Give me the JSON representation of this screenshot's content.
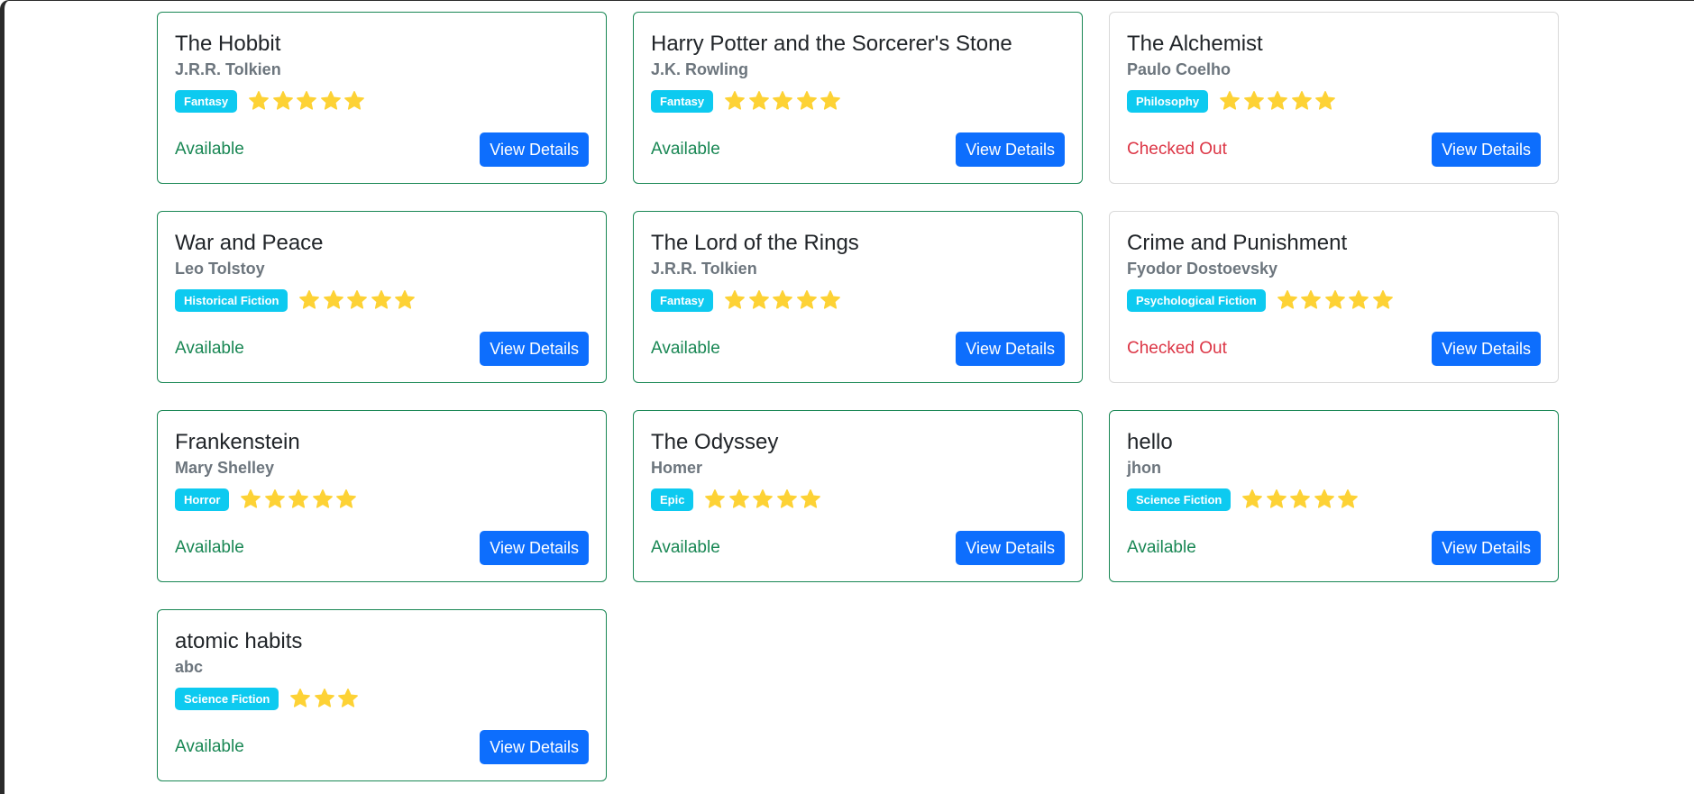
{
  "colors": {
    "available_border": "#198754",
    "checked_out_border": "#d9d9d9",
    "available_text": "#198754",
    "checked_out_text": "#dc3545",
    "badge_bg": "#0dcaf0",
    "button_bg": "#0d6efd",
    "star": "#fdd235"
  },
  "books": [
    {
      "title": "The Hobbit",
      "author": "J.R.R. Tolkien",
      "genre": "Fantasy",
      "rating": 5,
      "status": "Available",
      "available": true,
      "button_label": "View Details"
    },
    {
      "title": "Harry Potter and the Sorcerer's Stone",
      "author": "J.K. Rowling",
      "genre": "Fantasy",
      "rating": 5,
      "status": "Available",
      "available": true,
      "button_label": "View Details"
    },
    {
      "title": "The Alchemist",
      "author": "Paulo Coelho",
      "genre": "Philosophy",
      "rating": 5,
      "status": "Checked Out",
      "available": false,
      "button_label": "View Details"
    },
    {
      "title": "War and Peace",
      "author": "Leo Tolstoy",
      "genre": "Historical Fiction",
      "rating": 5,
      "status": "Available",
      "available": true,
      "button_label": "View Details"
    },
    {
      "title": "The Lord of the Rings",
      "author": "J.R.R. Tolkien",
      "genre": "Fantasy",
      "rating": 5,
      "status": "Available",
      "available": true,
      "button_label": "View Details"
    },
    {
      "title": "Crime and Punishment",
      "author": "Fyodor Dostoevsky",
      "genre": "Psychological Fiction",
      "rating": 5,
      "status": "Checked Out",
      "available": false,
      "button_label": "View Details"
    },
    {
      "title": "Frankenstein",
      "author": "Mary Shelley",
      "genre": "Horror",
      "rating": 5,
      "status": "Available",
      "available": true,
      "button_label": "View Details"
    },
    {
      "title": "The Odyssey",
      "author": "Homer",
      "genre": "Epic",
      "rating": 5,
      "status": "Available",
      "available": true,
      "button_label": "View Details"
    },
    {
      "title": "hello",
      "author": "jhon",
      "genre": "Science Fiction",
      "rating": 5,
      "status": "Available",
      "available": true,
      "button_label": "View Details"
    },
    {
      "title": "atomic habits",
      "author": "abc",
      "genre": "Science Fiction",
      "rating": 3,
      "status": "Available",
      "available": true,
      "button_label": "View Details"
    }
  ]
}
